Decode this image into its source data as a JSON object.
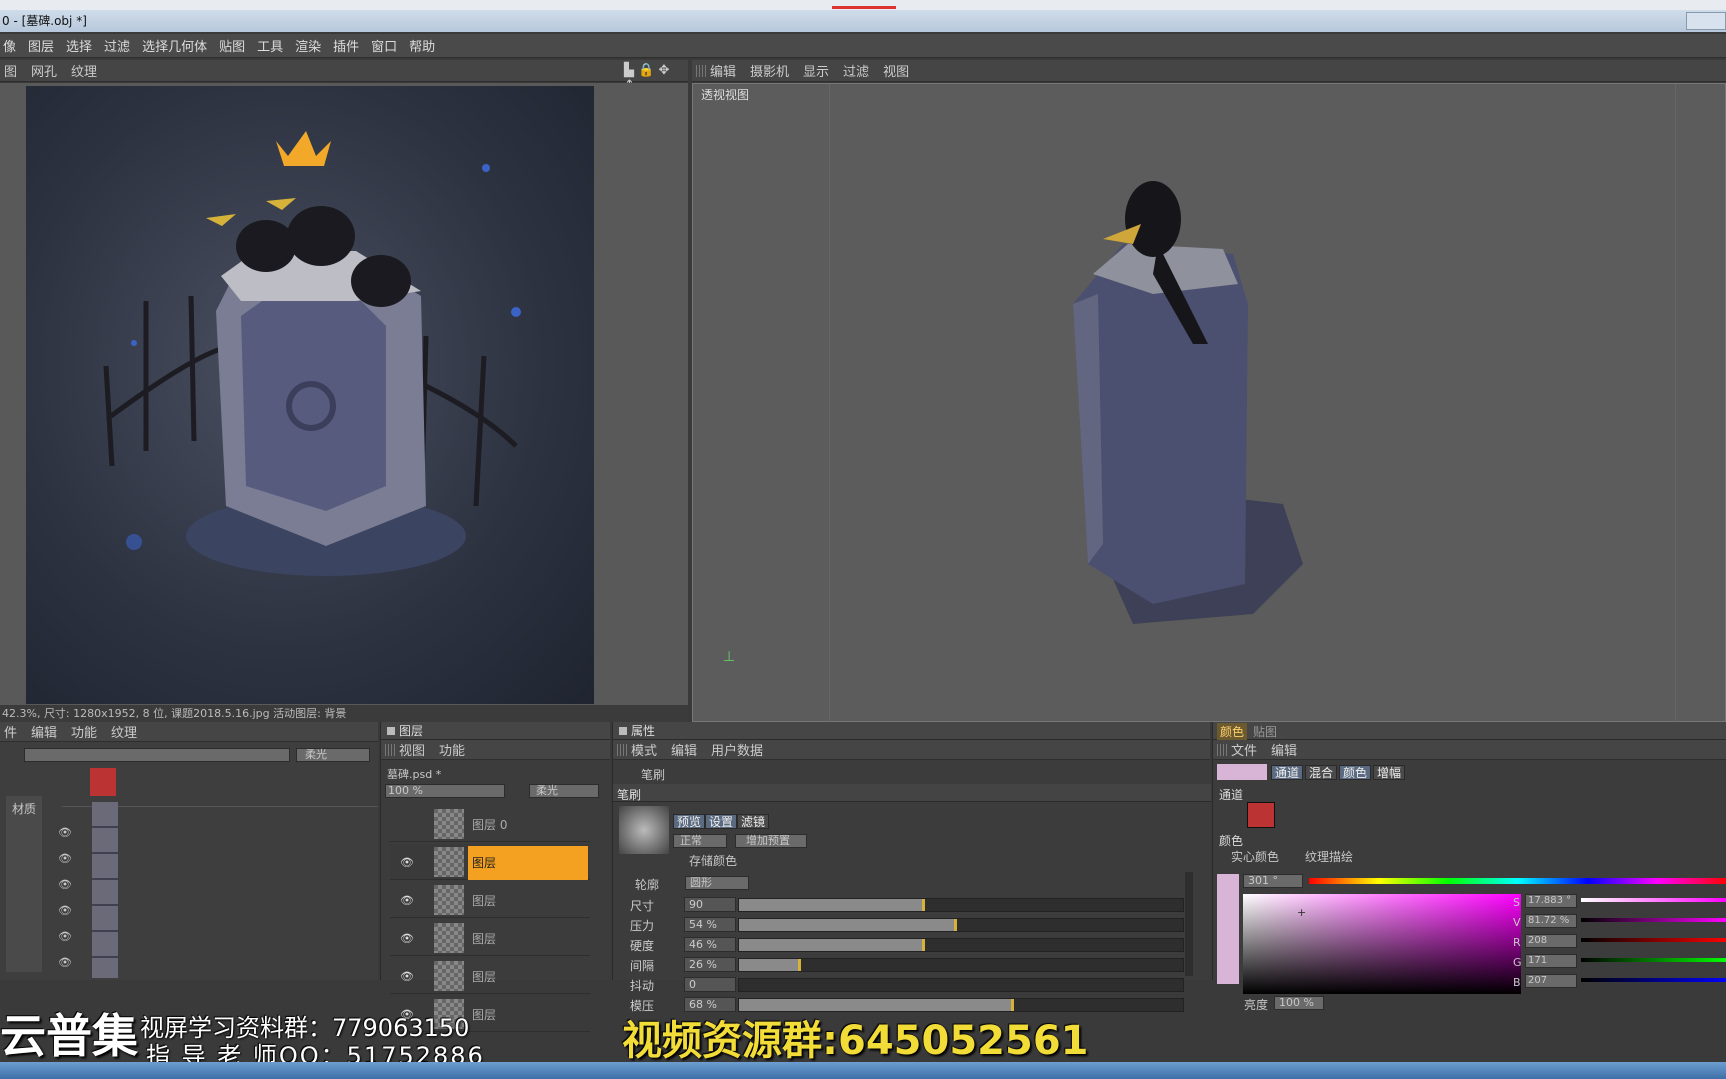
{
  "window": {
    "title": "0 - [墓碑.obj *]"
  },
  "menu": [
    "像",
    "图层",
    "选择",
    "过滤",
    "选择几何体",
    "贴图",
    "工具",
    "渲染",
    "插件",
    "窗口",
    "帮助"
  ],
  "left_subbar": [
    "图",
    "网孔",
    "纹理"
  ],
  "right_subbar": [
    "编辑",
    "摄影机",
    "显示",
    "过滤",
    "视图"
  ],
  "viewport": {
    "label": "透视视图"
  },
  "status": "42.3%, 尺寸: 1280x1952, 8 位, 课题2018.5.16.jpg 活动图层: 背景",
  "bottom_left": {
    "tabs": [
      "件",
      "编辑",
      "功能",
      "纹理"
    ],
    "blend": "柔光",
    "material_label": "材质"
  },
  "layers_panel": {
    "title": "图层",
    "menu": [
      "视图",
      "功能"
    ],
    "file": "墓碑.psd *",
    "opacity": "100 %",
    "blend": "柔光",
    "rows": [
      {
        "name": "图层 0",
        "active": false
      },
      {
        "name": "图层",
        "active": true
      },
      {
        "name": "图层",
        "active": false
      },
      {
        "name": "图层",
        "active": false
      },
      {
        "name": "图层",
        "active": false
      },
      {
        "name": "图层",
        "active": false
      }
    ]
  },
  "attributes": {
    "title": "属性",
    "menu": [
      "模式",
      "编辑",
      "用户数据"
    ],
    "brush_tool": "笔刷",
    "section": "笔刷",
    "tabs": [
      "预览",
      "设置",
      "滤镜"
    ],
    "mode": "正常",
    "add_preset": "增加预置",
    "store_color": "存储颜色",
    "shape_label": "轮廓",
    "shape_value": "圆形",
    "rows": [
      {
        "name": "尺寸",
        "value": "90",
        "fill": 0.42
      },
      {
        "name": "压力",
        "value": "54 %",
        "fill": 0.49
      },
      {
        "name": "硬度",
        "value": "46 %",
        "fill": 0.42
      },
      {
        "name": "间隔",
        "value": "26 %",
        "fill": 0.14
      },
      {
        "name": "抖动",
        "value": "0",
        "fill": 0.0
      },
      {
        "name": "模压",
        "value": "68 %",
        "fill": 0.62
      }
    ]
  },
  "color_panel": {
    "tabs": [
      "颜色",
      "贴图"
    ],
    "menu": [
      "文件",
      "编辑"
    ],
    "buttons": [
      "通道",
      "混合",
      "颜色",
      "增幅"
    ],
    "channel_label": "通道",
    "color_label": "颜色",
    "solid": "实心颜色",
    "texture": "纹理描绘",
    "hue": "301 °",
    "brightness_label": "亮度",
    "brightness": "100 %",
    "s": "17.883 °",
    "v": "81.72 %",
    "r": "208",
    "g": "171",
    "b": "207",
    "swatch": "#d0abcf"
  },
  "watermark": {
    "brand": "云普集",
    "line1": "视屏学习资料群：779063150",
    "line2": "指 导 老 师QQ：51752886",
    "group": "视频资源群:645052561"
  }
}
